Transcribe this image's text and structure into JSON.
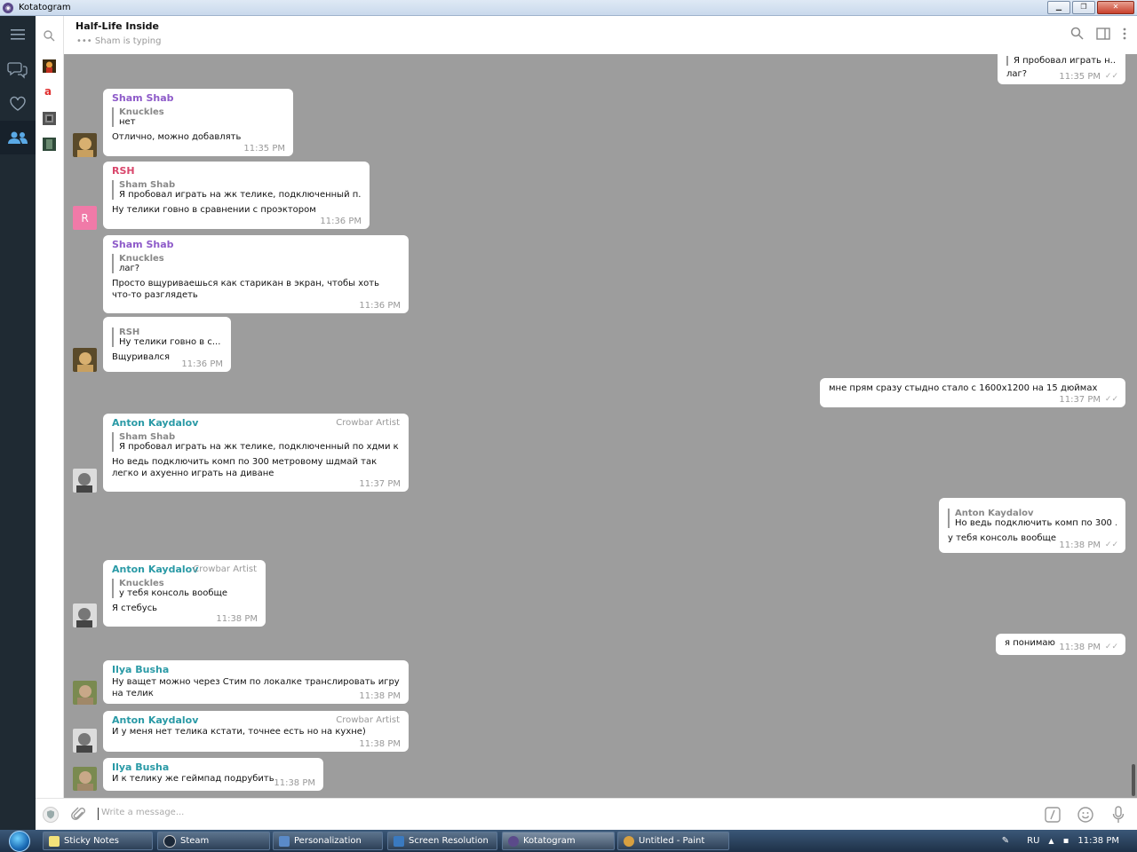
{
  "window": {
    "title": "Kotatogram",
    "min": "▭",
    "max": "▭",
    "close": "✕"
  },
  "chat": {
    "title": "Half-Life Inside",
    "typing": "Sham is typing",
    "typing_dots": "•••"
  },
  "input": {
    "placeholder": "Write a message..."
  },
  "messages": [
    {
      "reply_text": "Я пробовал играть н...",
      "text": "лаг?",
      "time": "11:35 PM"
    },
    {
      "sender": "Sham Shab",
      "reply_name": "Knuckles",
      "reply_text": "нет",
      "text": "Отлично, можно добавлять",
      "time": "11:35 PM"
    },
    {
      "sender": "RSH",
      "avatar_letter": "R",
      "reply_name": "Sham Shab",
      "reply_text": "Я пробовал играть на жк телике, подключенный п...",
      "text": "Ну телики говно в сравнении с проэктором",
      "time": "11:36 PM"
    },
    {
      "sender": "Sham Shab",
      "reply_name": "Knuckles",
      "reply_text": "лаг?",
      "text": "Просто вщуриваешься как старикан в экран, чтобы хоть что-то разглядеть",
      "time": "11:36 PM"
    },
    {
      "reply_name": "RSH",
      "reply_text": "Ну телики говно в с...",
      "text": "Вщуривался",
      "time": "11:36 PM"
    },
    {
      "text": "мне прям сразу стыдно стало с 1600х1200 на 15 дюймах",
      "time": "11:37 PM"
    },
    {
      "sender": "Anton Kaydalov",
      "badge": "Crowbar Artist",
      "reply_name": "Sham Shab",
      "reply_text": "Я пробовал играть на жк телике, подключенный по хдми к ...",
      "text": "Но ведь подключить комп по 300 метровому шдмай так легко и ахуенно играть на диване",
      "time": "11:37 PM"
    },
    {
      "reply_name": "Anton Kaydalov",
      "reply_text": "Но ведь подключить комп по 300 ...",
      "text": "у тебя консоль вообще",
      "time": "11:38 PM"
    },
    {
      "sender": "Anton Kaydalov",
      "badge": "Crowbar Artist",
      "reply_name": "Knuckles",
      "reply_text": "у тебя консоль вообще",
      "text": "Я стебусь",
      "time": "11:38 PM"
    },
    {
      "text": "я понимаю",
      "time": "11:38 PM"
    },
    {
      "sender": "Ilya Busha",
      "text": "Ну ващет можно через Стим по локалке транслировать игру на телик",
      "time": "11:38 PM"
    },
    {
      "sender": "Anton Kaydalov",
      "badge": "Crowbar Artist",
      "text": "И у меня нет телика кстати, точнее есть но на кухне)",
      "time": "11:38 PM"
    },
    {
      "sender": "Ilya Busha",
      "text": "И к телику же геймпад подрубить",
      "time": "11:38 PM"
    }
  ],
  "colors": {
    "sham": "#8e5bc9",
    "rsh": "#d9476c",
    "anton": "#2a9aa6",
    "ilya": "#2a9aa6",
    "chat_bg": "#9d9d9d",
    "rail": "#1f2a33",
    "accent": "#5aa9e6"
  },
  "taskbar": {
    "items": [
      {
        "label": "Sticky Notes"
      },
      {
        "label": "Steam"
      },
      {
        "label": "Personalization"
      },
      {
        "label": "Screen Resolution"
      },
      {
        "label": "Kotatogram"
      },
      {
        "label": "Untitled - Paint"
      }
    ],
    "lang": "RU",
    "clock": "11:38 PM"
  }
}
